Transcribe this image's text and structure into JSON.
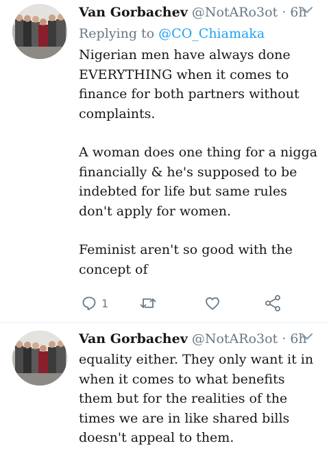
{
  "tweets": [
    {
      "author": {
        "name": "Van Gorbachev",
        "handle": "@NotARo3ot",
        "time": "6h"
      },
      "replying_prefix": "Replying to",
      "replying_to": "@CO_Chiamaka",
      "paragraphs": [
        "Nigerian men have always done EVERYTHING when it comes to finance for both partners without complaints.",
        "A woman does one thing for a nigga financially & he's supposed to be indebted for life but same rules don't apply for women.",
        "Feminist aren't so good with the concept of"
      ],
      "actions": {
        "reply_count": "1",
        "icons": [
          "reply-icon",
          "retweet-icon",
          "like-icon",
          "share-icon"
        ]
      }
    },
    {
      "author": {
        "name": "Van Gorbachev",
        "handle": "@NotARo3ot",
        "time": "6h"
      },
      "paragraphs": [
        "equality either. They only want it in when it comes to what benefits them but for the realities of the times we are in like shared bills doesn't appeal to them."
      ]
    }
  ],
  "colors": {
    "text": "#14171a",
    "secondary": "#657786",
    "mention": "#1da1f2",
    "divider": "#e6ecf0"
  }
}
